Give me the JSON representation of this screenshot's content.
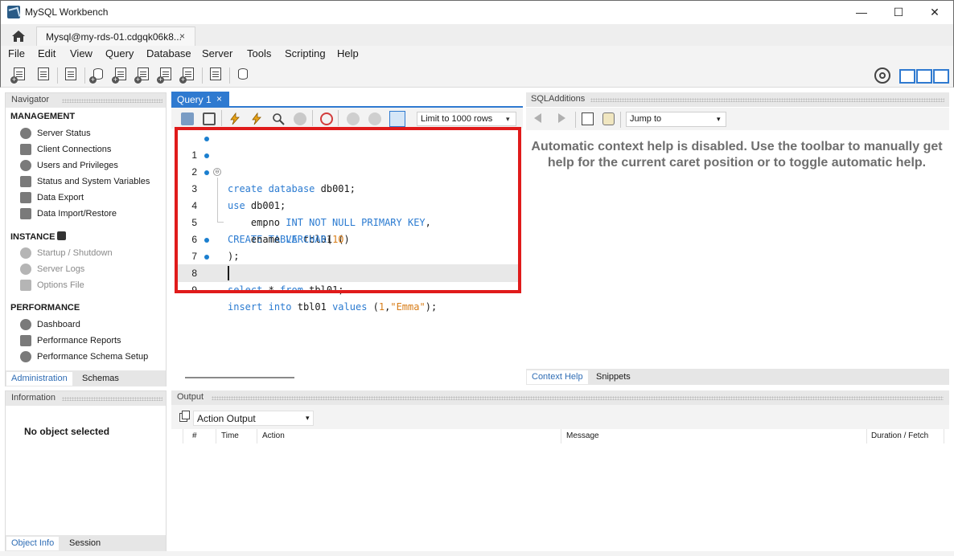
{
  "window": {
    "title": "MySQL Workbench",
    "minimize_glyph": "—",
    "maximize_glyph": "☐",
    "close_glyph": "✕"
  },
  "tabs": {
    "home_icon": "home-icon",
    "connection_tab_label": "Mysql@my-rds-01.cdgqk06k8...",
    "close_glyph": "×"
  },
  "menu": [
    "File",
    "Edit",
    "View",
    "Query",
    "Database",
    "Server",
    "Tools",
    "Scripting",
    "Help"
  ],
  "navigator": {
    "header": "Navigator",
    "management_title": "MANAGEMENT",
    "management_items": [
      "Server Status",
      "Client Connections",
      "Users and Privileges",
      "Status and System Variables",
      "Data Export",
      "Data Import/Restore"
    ],
    "instance_title": "INSTANCE",
    "instance_items": [
      "Startup / Shutdown",
      "Server Logs",
      "Options File"
    ],
    "performance_title": "PERFORMANCE",
    "performance_items": [
      "Dashboard",
      "Performance Reports",
      "Performance Schema Setup"
    ],
    "tabs": [
      "Administration",
      "Schemas"
    ]
  },
  "information": {
    "header": "Information",
    "message": "No object selected",
    "tabs": [
      "Object Info",
      "Session"
    ]
  },
  "query": {
    "tab_label": "Query 1",
    "tab_close": "×",
    "limit_label": "Limit to 1000 rows",
    "dropdown_glyph": "▾",
    "line_numbers": [
      "1",
      "2",
      "3",
      "4",
      "5",
      "6",
      "7",
      "8",
      "9"
    ],
    "code": {
      "l1_kw1": "create",
      "l1_kw2": "database",
      "l1_rest": " db001;",
      "l2_kw": "use",
      "l2_rest": " db001;",
      "l3_kw1": "CREATE",
      "l3_kw2": "TABLE",
      "l3_rest": " tbl01 (",
      "l4_id": "    empno ",
      "l4_kw": "INT NOT NULL PRIMARY KEY",
      "l4_rest": ",",
      "l5_id": "    ename ",
      "l5_kw": "VARCHAR",
      "l5_p1": "(",
      "l5_num": "10",
      "l5_p2": ")",
      "l6": ");",
      "l7_kw1": "select",
      "l7_mid": " * ",
      "l7_kw2": "from",
      "l7_rest": " tbl01;",
      "l8_kw1": "insert",
      "l8_kw2": "into",
      "l8_mid": " tbl01 ",
      "l8_kw3": "values",
      "l8_p1": " (",
      "l8_num": "1",
      "l8_comma": ",",
      "l8_str": "\"Emma\"",
      "l8_end": ");",
      "fold_glyph": "⊖"
    }
  },
  "sql_additions": {
    "header": "SQLAdditions",
    "jump_label": "Jump to",
    "message": "Automatic context help is disabled. Use the toolbar to manually get help for the current caret position or to toggle automatic help.",
    "tabs": [
      "Context Help",
      "Snippets"
    ]
  },
  "output": {
    "header": "Output",
    "select_label": "Action Output",
    "columns": [
      "#",
      "Time",
      "Action",
      "Message",
      "Duration / Fetch"
    ]
  },
  "colors": {
    "accent": "#2f7ad0",
    "keyword": "#2b7bd1",
    "string_number": "#d87d18",
    "highlight_box": "#e01b1b"
  }
}
